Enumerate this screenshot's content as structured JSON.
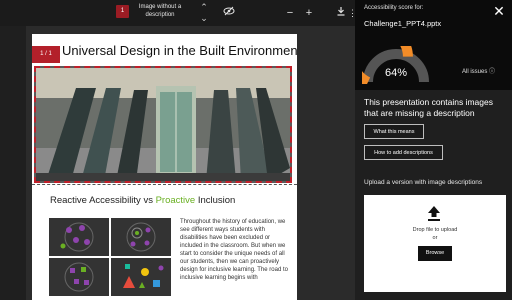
{
  "toolbar": {
    "issue_badge_label": "1",
    "issue_title": "Image without a description",
    "up_icon": "chevron-up-icon",
    "down_icon": "chevron-down-icon",
    "eye_icon": "eye-slash-icon",
    "zoom_out_icon": "minus-icon",
    "zoom_in_icon": "plus-icon",
    "download_icon": "download-icon",
    "more_icon": "more-vertical-icon"
  },
  "document": {
    "slide1": {
      "badge": "1 / 1",
      "title": "Universal Design in the Built Environment"
    },
    "slide2": {
      "title_part1": "Reactive Accessibility vs ",
      "title_highlight": "Proactive",
      "title_part2": " Inclusion",
      "body": "Throughout the history of education, we see different ways students with disabilities have been excluded or included in the classroom. But when we start to consider the unique needs of all our students, then we can proactively design for inclusive learning. The road to inclusive learning begins with"
    }
  },
  "panel": {
    "close_icon": "close-icon",
    "score_label": "Accessibility score for:",
    "file_name": "Challenge1_PPT4.pptx",
    "score_text": "64%",
    "score_value": 0.64,
    "all_issues": "All issues",
    "description": "This presentation contains images that are missing a description",
    "what_means_btn": "What this means",
    "how_add_btn": "How to add descriptions",
    "upload_label": "Upload a version with image descriptions",
    "drop_text": "Drop file to upload",
    "or_text": "or",
    "browse_btn": "Browse"
  },
  "colors": {
    "accent_orange": "#f28c28",
    "badge_red": "#9b1c24",
    "highlight_green": "#6ab023"
  }
}
